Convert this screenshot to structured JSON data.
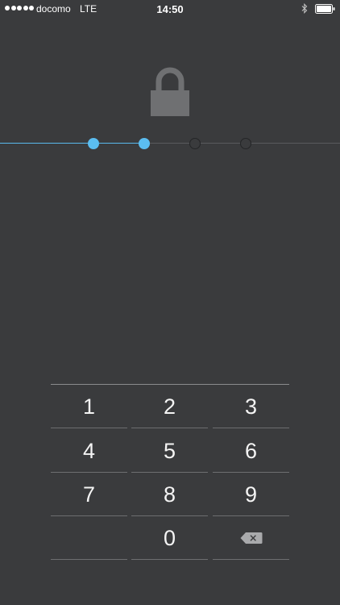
{
  "status_bar": {
    "signal_bars": 5,
    "carrier": "docomo",
    "network": "LTE",
    "time": "14:50",
    "bluetooth_icon": "bluetooth-icon",
    "battery_icon": "battery-icon"
  },
  "lock": {
    "icon": "padlock-icon",
    "color": "#6f7072"
  },
  "passcode": {
    "length": 4,
    "entered": 2,
    "accent_color": "#5bbdf0"
  },
  "keypad": {
    "keys": [
      "1",
      "2",
      "3",
      "4",
      "5",
      "6",
      "7",
      "8",
      "9",
      "",
      "0",
      "delete"
    ],
    "digits": {
      "k1": "1",
      "k2": "2",
      "k3": "3",
      "k4": "4",
      "k5": "5",
      "k6": "6",
      "k7": "7",
      "k8": "8",
      "k9": "9",
      "k0": "0"
    },
    "delete_icon": "backspace-icon"
  }
}
